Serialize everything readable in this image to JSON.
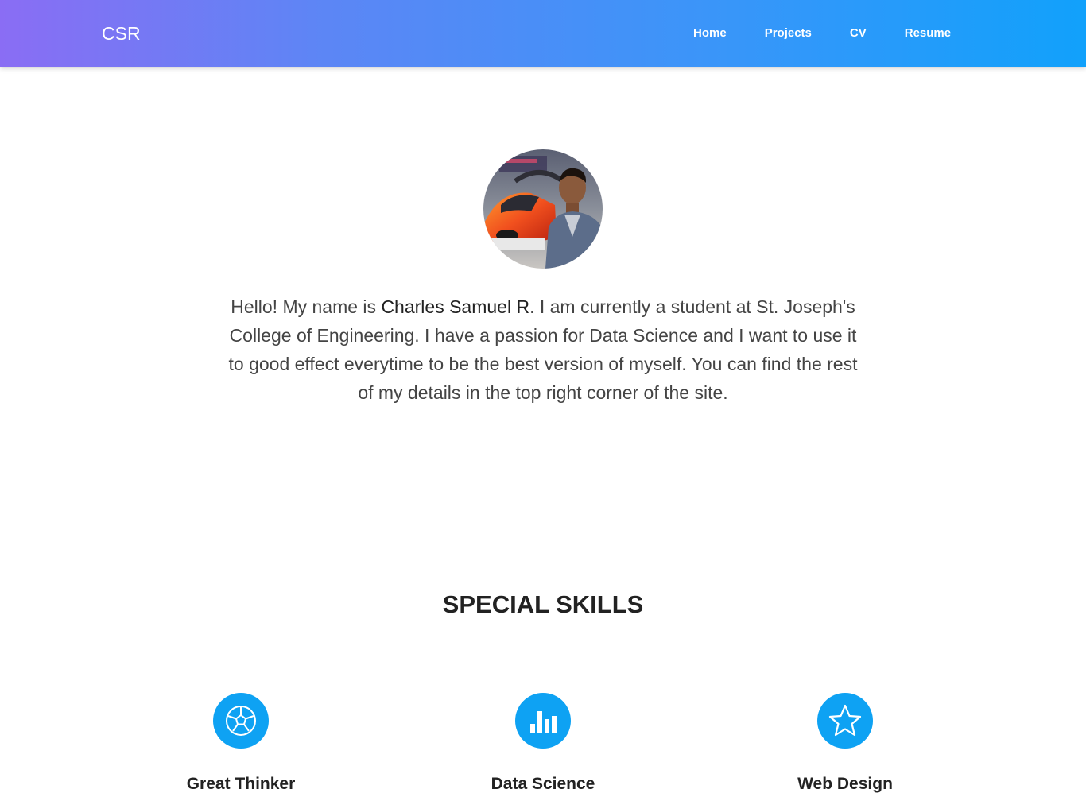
{
  "nav": {
    "brand": "CSR",
    "links": [
      {
        "label": "Home"
      },
      {
        "label": "Projects"
      },
      {
        "label": "CV"
      },
      {
        "label": "Resume"
      }
    ]
  },
  "intro": {
    "before": "Hello! My name is ",
    "name": "Charles Samuel R",
    "after": ". I am currently a student at St. Joseph's College of Engineering. I have a passion for Data Science and I want to use it to good effect everytime to be the best version of myself. You can find the rest of my details in the top right corner of the site."
  },
  "skills": {
    "title": "SPECIAL SKILLS",
    "items": [
      {
        "label": "Great Thinker",
        "icon": "soccer-ball-icon"
      },
      {
        "label": "Data Science",
        "icon": "bar-chart-icon"
      },
      {
        "label": "Web Design",
        "icon": "star-icon"
      }
    ]
  },
  "colors": {
    "nav_gradient_start": "#8a6df4",
    "nav_gradient_end": "#11a1fb",
    "skill_icon_bg": "#0ea2f3"
  }
}
